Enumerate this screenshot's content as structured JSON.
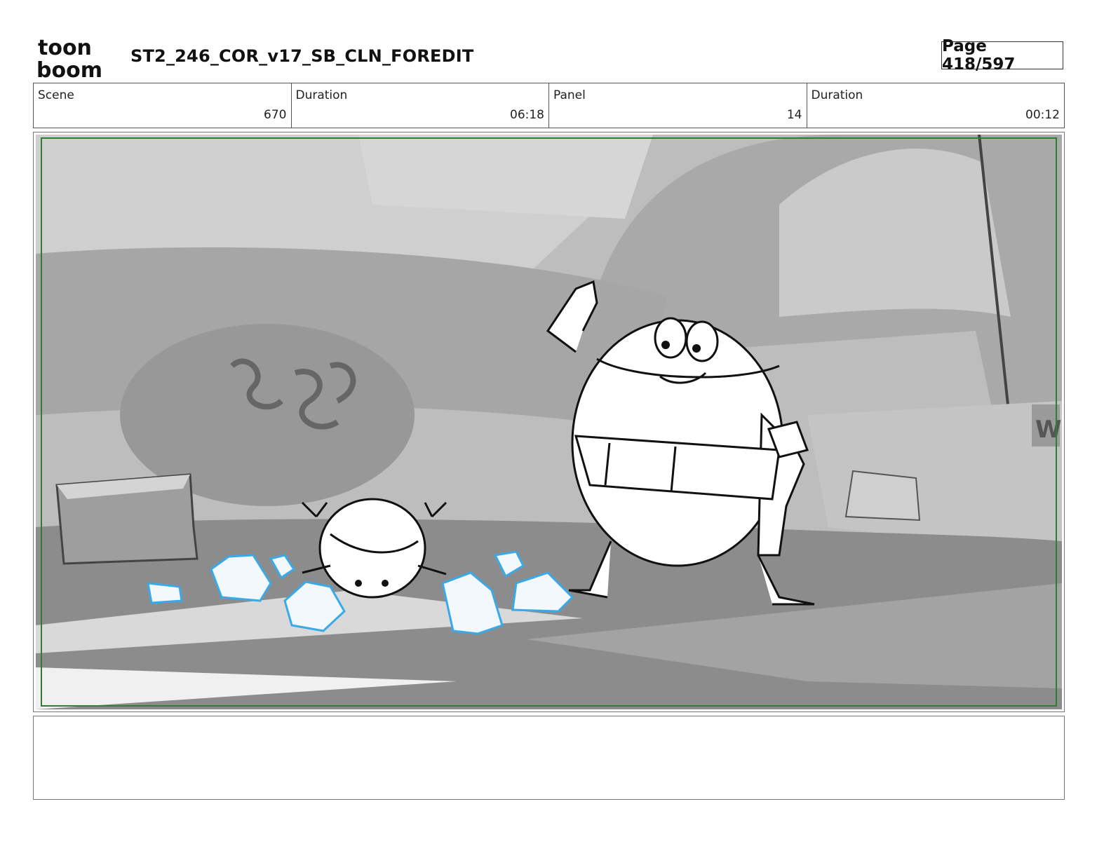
{
  "header": {
    "logo_text_top": "toon",
    "logo_text_bottom": "boom",
    "title": "ST2_246_COR_v17_SB_CLN_FOREDIT",
    "page": "Page 418/597"
  },
  "info": [
    {
      "label": "Scene",
      "value": "670"
    },
    {
      "label": "Duration",
      "value": "06:18"
    },
    {
      "label": "Panel",
      "value": "14"
    },
    {
      "label": "Duration",
      "value": "00:12"
    }
  ],
  "panel": {
    "sign_text": "W"
  },
  "notes": {
    "text": ""
  },
  "colors": {
    "safe_frame": "#2e7d32",
    "ice_lines": "#3aa9e8"
  }
}
